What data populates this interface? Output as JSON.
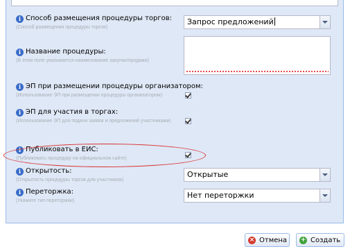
{
  "form": {
    "fields": [
      {
        "label": "Способ размещения процедуры торгов:",
        "hint": "(Способ размещения процедуры торгов)",
        "value": "Запрос предложений"
      },
      {
        "label": "Название процедуры:",
        "hint": "(В этом поле указывается наименование закупки/продажи)",
        "value": ""
      },
      {
        "label": "ЭП при размещении процедуры организатором:",
        "hint": "(Использование ЭП при размещении процедуры организатором)",
        "checked": true
      },
      {
        "label": "ЭП для участия в торгах:",
        "hint": "(Использование ЭП для подачи заявок и предложений участниками)",
        "checked": true
      },
      {
        "label": "Публиковать в ЕИС:",
        "hint": "(Публиковать процедуру на официальном сайте)",
        "checked": true
      },
      {
        "label": "Открытость:",
        "hint": "(Открытость процедуры торгов для участников)",
        "value": "Открытые"
      },
      {
        "label": "Переторжка:",
        "hint": "(Укажите тип переторжки)",
        "value": "Нет переторжки"
      }
    ]
  },
  "footer": {
    "cancel_label": "Отмена",
    "save_label": "Создать"
  },
  "colors": {
    "panel_bg": "#dfe8f6",
    "info_icon": "#3a6cc8",
    "highlight_ellipse": "#d9302e",
    "cancel_icon": "#d43a2f",
    "save_icon": "#3fa33a"
  }
}
